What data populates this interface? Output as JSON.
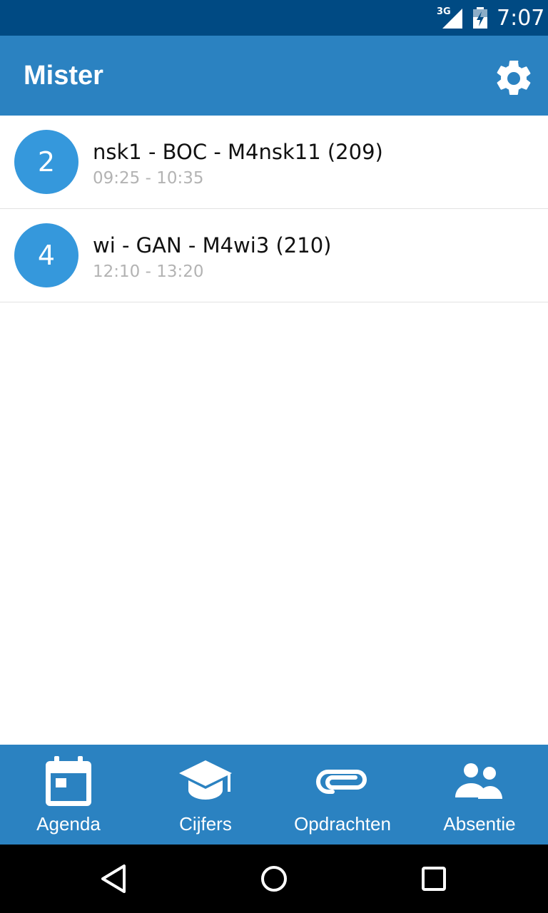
{
  "status_bar": {
    "network": "3G",
    "time": "7:07",
    "icons": [
      "signal-icon",
      "battery-charging-icon"
    ]
  },
  "app_bar": {
    "title": "Mister",
    "settings_icon": "gear-icon"
  },
  "lessons": [
    {
      "hour": "2",
      "title": "nsk1 - BOC - M4nsk11 (209)",
      "time": "09:25 - 10:35"
    },
    {
      "hour": "4",
      "title": "wi - GAN - M4wi3 (210)",
      "time": "12:10 - 13:20"
    }
  ],
  "bottom_nav": [
    {
      "label": "Agenda",
      "icon": "calendar-icon"
    },
    {
      "label": "Cijfers",
      "icon": "graduation-cap-icon"
    },
    {
      "label": "Opdrachten",
      "icon": "paperclip-icon"
    },
    {
      "label": "Absentie",
      "icon": "people-icon"
    }
  ],
  "system_nav": {
    "icons": [
      "back-icon",
      "home-icon",
      "recents-icon"
    ]
  },
  "colors": {
    "status_bar": "#004a83",
    "primary": "#2b82c1",
    "badge": "#3598dc",
    "secondary_text": "#b3b3b3"
  }
}
